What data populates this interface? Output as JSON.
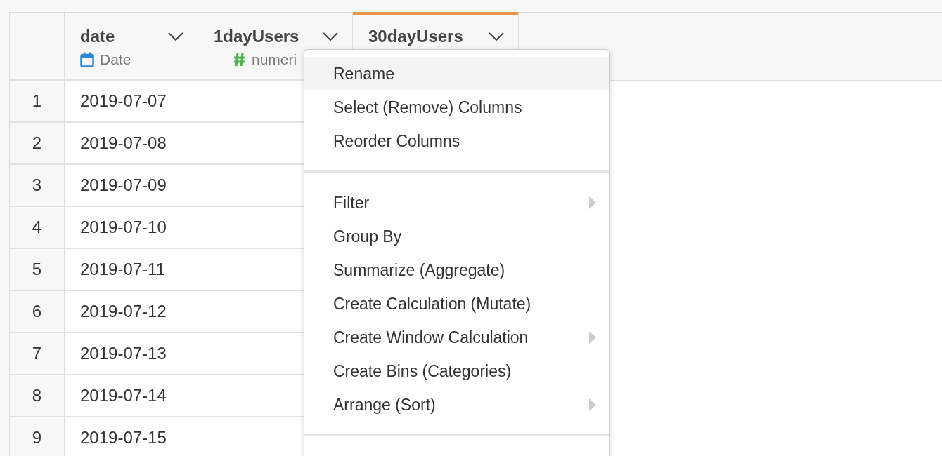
{
  "table": {
    "columns": [
      {
        "name": "date",
        "type": "Date",
        "kind": "date",
        "selected": false
      },
      {
        "name": "1dayUsers",
        "type": "numeri",
        "kind": "numeric",
        "selected": false
      },
      {
        "name": "30dayUsers",
        "selected": true
      }
    ],
    "rows": [
      {
        "index": "1",
        "date": "2019-07-07"
      },
      {
        "index": "2",
        "date": "2019-07-08"
      },
      {
        "index": "3",
        "date": "2019-07-09"
      },
      {
        "index": "4",
        "date": "2019-07-10"
      },
      {
        "index": "5",
        "date": "2019-07-11"
      },
      {
        "index": "6",
        "date": "2019-07-12"
      },
      {
        "index": "7",
        "date": "2019-07-13"
      },
      {
        "index": "8",
        "date": "2019-07-14"
      },
      {
        "index": "9",
        "date": "2019-07-15"
      }
    ]
  },
  "column_menu": {
    "groups": [
      [
        {
          "label": "Rename",
          "highlighted": true,
          "submenu": false
        },
        {
          "label": "Select (Remove) Columns",
          "highlighted": false,
          "submenu": false
        },
        {
          "label": "Reorder Columns",
          "highlighted": false,
          "submenu": false
        }
      ],
      [
        {
          "label": "Filter",
          "highlighted": false,
          "submenu": true
        },
        {
          "label": "Group By",
          "highlighted": false,
          "submenu": false
        },
        {
          "label": "Summarize (Aggregate)",
          "highlighted": false,
          "submenu": false
        },
        {
          "label": "Create Calculation (Mutate)",
          "highlighted": false,
          "submenu": false
        },
        {
          "label": "Create Window Calculation",
          "highlighted": false,
          "submenu": true
        },
        {
          "label": "Create Bins (Categories)",
          "highlighted": false,
          "submenu": false
        },
        {
          "label": "Arrange (Sort)",
          "highlighted": false,
          "submenu": true
        }
      ]
    ]
  }
}
